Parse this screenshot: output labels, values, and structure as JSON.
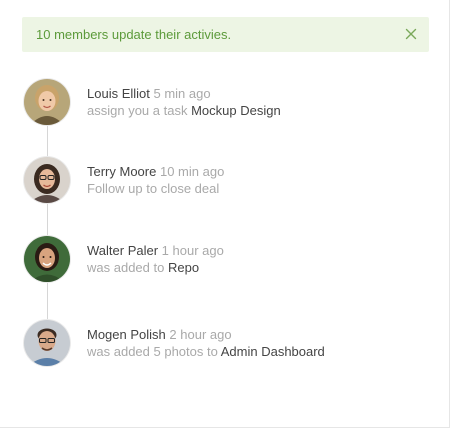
{
  "alert": {
    "text": "10 members update their activies.",
    "close_icon": "close-icon"
  },
  "activities": [
    {
      "name": "Louis Elliot",
      "time": "5 min ago",
      "action": "assign you a task",
      "target": "Mockup Design",
      "avatar_colors": {
        "bg": "#b7a679",
        "hair": "#c9a36a",
        "skin": "#f0c9a8",
        "shirt": "#6a5a3a"
      }
    },
    {
      "name": "Terry Moore",
      "time": "10 min ago",
      "action": "Follow up to close deal",
      "target": "",
      "avatar_colors": {
        "bg": "#d9d3cc",
        "hair": "#3a2a20",
        "skin": "#e6b99a",
        "shirt": "#5a4a45"
      }
    },
    {
      "name": "Walter Paler",
      "time": "1 hour ago",
      "action": "was added to",
      "target": "Repo",
      "avatar_colors": {
        "bg": "#3f6b3a",
        "hair": "#2a1b14",
        "skin": "#d8a37f",
        "shirt": "#2f4f2a"
      }
    },
    {
      "name": "Mogen Polish",
      "time": "2 hour ago",
      "action": "was added 5 photos to",
      "target": "Admin Dashboard",
      "avatar_colors": {
        "bg": "#c7ccd2",
        "hair": "#3b2b22",
        "skin": "#d9a98a",
        "shirt": "#5b7fa8"
      }
    }
  ]
}
